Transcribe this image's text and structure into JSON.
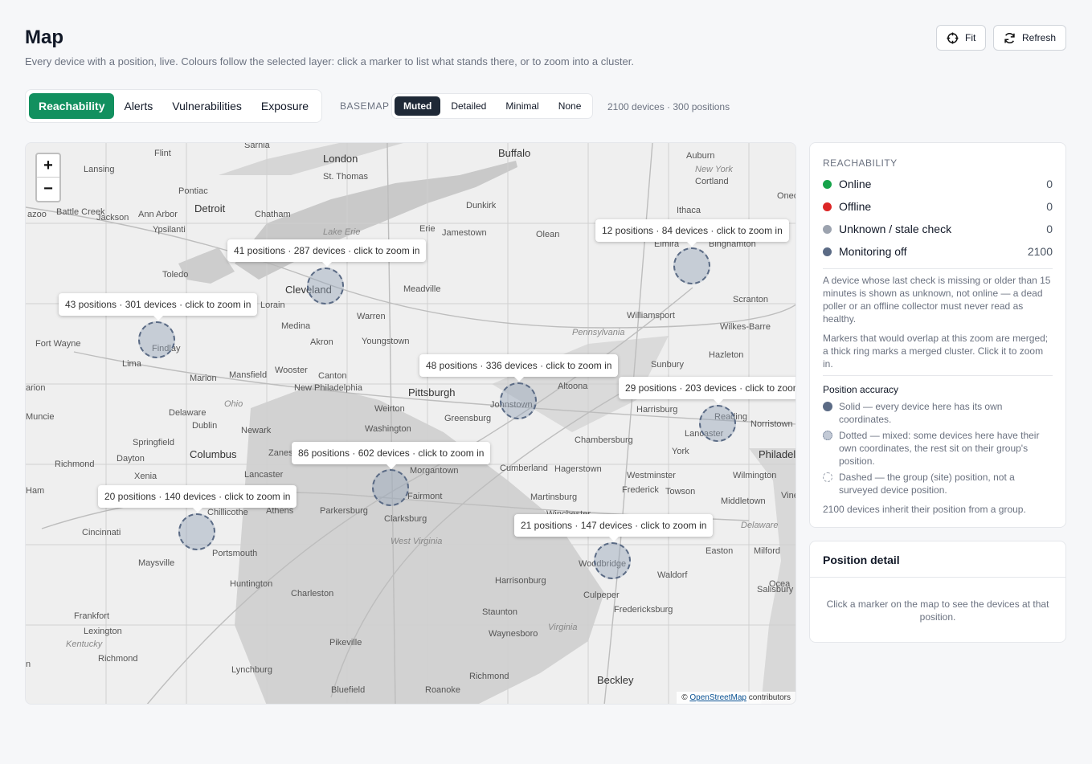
{
  "header": {
    "title": "Map",
    "subtitle": "Every device with a position, live. Colours follow the selected layer: click a marker to list what stands there, or to zoom into a cluster.",
    "fit_label": "Fit",
    "refresh_label": "Refresh"
  },
  "layers": [
    {
      "label": "Reachability",
      "active": true
    },
    {
      "label": "Alerts",
      "active": false
    },
    {
      "label": "Vulnerabilities",
      "active": false
    },
    {
      "label": "Exposure",
      "active": false
    }
  ],
  "basemap": {
    "label": "BASEMAP",
    "options": [
      {
        "label": "Muted",
        "active": true
      },
      {
        "label": "Detailed",
        "active": false
      },
      {
        "label": "Minimal",
        "active": false
      },
      {
        "label": "None",
        "active": false
      }
    ]
  },
  "summary": "2100 devices · 300 positions",
  "map": {
    "zoom_in": "+",
    "zoom_out": "−",
    "attribution_prefix": "© ",
    "attribution_link": "OpenStreetMap",
    "attribution_suffix": " contributors",
    "clusters": [
      {
        "label": "41 positions · 287 devices · click to zoom in"
      },
      {
        "label": "43 positions · 301 devices · click to zoom in"
      },
      {
        "label": "12 positions · 84 devices · click to zoom in"
      },
      {
        "label": "48 positions · 336 devices · click to zoom in"
      },
      {
        "label": "29 positions · 203 devices · click to zoom in"
      },
      {
        "label": "86 positions · 602 devices · click to zoom in"
      },
      {
        "label": "20 positions · 140 devices · click to zoom in"
      },
      {
        "label": "21 positions · 147 devices · click to zoom in"
      }
    ],
    "places": [
      "Flint",
      "Sarnia",
      "London",
      "Buffalo",
      "Auburn",
      "New York",
      "Cortland",
      "Lansing",
      "St. Thomas",
      "Pontiac",
      "Detroit",
      "Chatham",
      "Dunkirk",
      "Ithaca",
      "Oneo",
      "Battle Creek",
      "Jackson",
      "Ann Arbor",
      "Ypsilanti",
      "azoo",
      "Lake Erie",
      "Erie",
      "Jamestown",
      "Olean",
      "Elmira",
      "Binghamton",
      "Toledo",
      "Cleveland",
      "Meadville",
      "Lorain",
      "Scranton",
      "Williamsport",
      "Fort Wayne",
      "Findlay",
      "Medina",
      "Warren",
      "Akron",
      "Youngstown",
      "Pennsylvania",
      "Wilkes-Barre",
      "Hazleton",
      "Lima",
      "Marion",
      "Mansfield",
      "Wooster",
      "Canton",
      "Sunbury",
      "arion",
      "New Philadelphia",
      "Pittsburgh",
      "Altoona",
      "Ohio",
      "Johnstown",
      "Harrisburg",
      "Reading",
      "Norristown",
      "Muncie",
      "Delaware",
      "Weirton",
      "Greensburg",
      "Dublin",
      "Washington",
      "Newark",
      "Lancaster",
      "Chambersburg",
      "Springfield",
      "Columbus",
      "Zanesv",
      "Morgantown",
      "Cumberland",
      "York",
      "Philadel",
      "Dayton",
      "Richmond",
      "Xenia",
      "Lancaster",
      "Hagerstown",
      "Westminster",
      "Wilmington",
      "Parkersburg",
      "Fairmont",
      "Martinsburg",
      "Frederick",
      "Towson",
      "Ham",
      "Chillicothe",
      "Athens",
      "Clarksburg",
      "Winchester",
      "Middletown",
      "Vine",
      "Cincinnati",
      "West Virginia",
      "Delaware",
      "Portsmouth",
      "Easton",
      "Milford",
      "Maysville",
      "Woodbridge",
      "Waldorf",
      "Huntington",
      "Harrisonburg",
      "Ocea",
      "Charleston",
      "Culpeper",
      "Salisbury",
      "Frankfort",
      "Staunton",
      "Fredericksburg",
      "Lexington",
      "Kentucky",
      "Waynesboro",
      "Virginia",
      "Richmond",
      "Beckley",
      "Pikeville",
      "Lynchburg",
      "Richmond",
      "Bluefield",
      "Roanoke",
      "n"
    ]
  },
  "legend": {
    "title": "REACHABILITY",
    "items": [
      {
        "label": "Online",
        "count": "0",
        "color": "#16a34a"
      },
      {
        "label": "Offline",
        "count": "0",
        "color": "#dc2626"
      },
      {
        "label": "Unknown / stale check",
        "count": "0",
        "color": "#9ca3af"
      },
      {
        "label": "Monitoring off",
        "count": "2100",
        "color": "#5b6b85"
      }
    ],
    "note1": "A device whose last check is missing or older than 15 minutes is shown as unknown, not online — a dead poller or an offline collector must never read as healthy.",
    "note2": "Markers that would overlap at this zoom are merged; a thick ring marks a merged cluster. Click it to zoom in.",
    "accuracy_title": "Position accuracy",
    "accuracy": [
      {
        "label": "Solid — every device here has its own coordinates.",
        "style": "solid"
      },
      {
        "label": "Dotted — mixed: some devices here have their own coordinates, the rest sit on their group's position.",
        "style": "dotted"
      },
      {
        "label": "Dashed — the group (site) position, not a surveyed device position.",
        "style": "dashed"
      }
    ],
    "inherit_note": "2100 devices inherit their position from a group."
  },
  "detail": {
    "title": "Position detail",
    "empty": "Click a marker on the map to see the devices at that position."
  }
}
